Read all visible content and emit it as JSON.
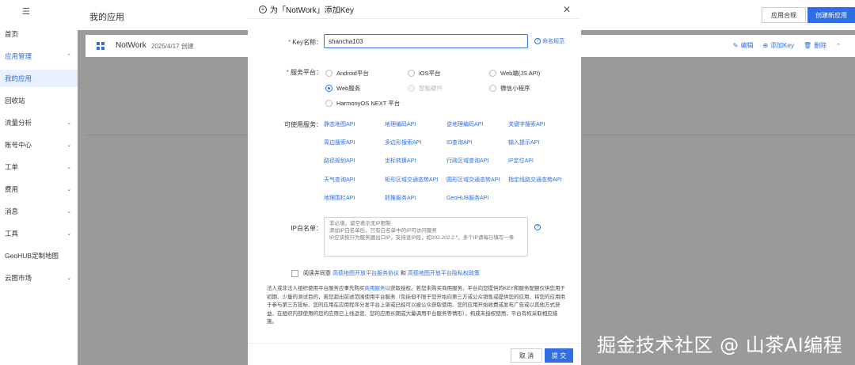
{
  "sidebar": {
    "menu_icon": "☰",
    "items": [
      {
        "label": "首页",
        "chevron": ""
      },
      {
        "label": "应用管理",
        "chevron": "⌃"
      },
      {
        "label": "我的应用",
        "chevron": ""
      },
      {
        "label": "回收站",
        "chevron": ""
      },
      {
        "label": "流量分析",
        "chevron": "⌄"
      },
      {
        "label": "账号中心",
        "chevron": "⌄"
      },
      {
        "label": "工单",
        "chevron": "⌄"
      },
      {
        "label": "费用",
        "chevron": "⌄"
      },
      {
        "label": "消息",
        "chevron": "⌄"
      },
      {
        "label": "工具",
        "chevron": "⌄"
      },
      {
        "label": "GeoHUB定制地图",
        "chevron": ""
      },
      {
        "label": "云图市场",
        "chevron": "⌄"
      }
    ]
  },
  "header": {
    "title": "我的应用",
    "compliance_label": "应用合规",
    "create_label": "创建新应用"
  },
  "app_card": {
    "name": "NotWork",
    "date": "2025/4/17 创建",
    "edit_label": "编辑",
    "add_key_label": "添加Key",
    "delete_label": "删除",
    "collapse_icon": "⌃"
  },
  "modal": {
    "title": "为「NotWork」添加Key",
    "plus_glyph": "+",
    "close_glyph": "✕",
    "key_label": "Key名称：",
    "key_value": "shancha103",
    "naming_rule": "命名规范",
    "platform_label": "服务平台：",
    "platforms": [
      "Android平台",
      "iOS平台",
      "Web端(JS API)",
      "Web服务",
      "智能硬件",
      "微信小程序",
      "HarmonyOS NEXT 平台"
    ],
    "services_label": "可使用服务：",
    "services": [
      [
        "静态地图API",
        "地理编码API",
        "逆地理编码API",
        "关键字搜索API"
      ],
      [
        "周边搜索API",
        "多边形搜索API",
        "ID查询API",
        "输入提示API"
      ],
      [
        "路径规划API",
        "坐标转换API",
        "行政区域查询API",
        "IP定位API"
      ],
      [
        "天气查询API",
        "矩形区域交通态势API",
        "圆形区域交通态势API",
        "指定线路交通态势API"
      ],
      [
        "地理围栏API",
        "抓推服务API",
        "GeoHUB服务API"
      ]
    ],
    "ip_label": "IP白名单：",
    "ip_placeholder": "非必填，留空表示无IP限制\n添加IP白名单后，只有白名单中的IP可访问服务\nIP应该按行为服务器出口IP，支持设IP段，如202.202.2.*，多个IP请每行填写一条",
    "agree_prefix": "阅读并同意",
    "agree_link1": "高德地图开放平台服务协议",
    "agree_and": "和",
    "agree_link2": "高德地图开放平台隐私权政策",
    "notice_1": "法人或非法人组织使用平台服务应事先购买",
    "notice_link": "商用服务",
    "notice_2": "以获取授权。若您未购买商用服务，平台向您提供的KEY和服务配额仅供您用于初期、少量的测试目的，若您超出前述范围使用平台服务（包括但不限于您开始向第三方或公众销售或提供您的应用、将您的应用用于参与第三方投标、您的应用在应用程序分发平台上架或已经可以被公众获取使用、您的应用开始收费或发布广告或以其他方式获益、在组织内部使用的您的应用已上线运营、您的应用长期或大量调用平台服务等情形），构成未授权使用，平台有权采取相应措施。",
    "cancel_label": "取 消",
    "submit_label": "提 交"
  },
  "watermark": "掘金技术社区 @ 山茶AI编程"
}
